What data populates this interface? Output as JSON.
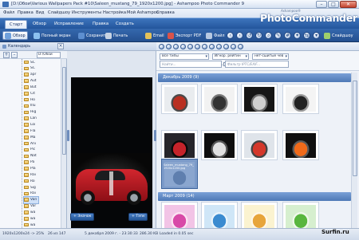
{
  "window": {
    "title": "[D:\\Обои\\Various Wallpapers Pack #10\\Saleen_mustang_79_1920x1200.jpg] - Ashampoo Photo Commander 9",
    "minimize": "–",
    "maximize": "□",
    "close": "✕"
  },
  "menubar": {
    "items": [
      "Файл",
      "Правка",
      "Вид",
      "Слайдшоу",
      "Инструменты",
      "Настройка",
      "Мой Ashampoo",
      "Справка"
    ]
  },
  "logo": {
    "brand": "Ashampoo®",
    "product": "PhotoCommander 9"
  },
  "tabs": [
    "Старт",
    "Обзор",
    "Исправление",
    "Правка",
    "Создать"
  ],
  "toolbar": {
    "items": [
      "Обзор",
      "Полный экран",
      "Сохранить",
      "Печать",
      "Email",
      "Экспорт PDF",
      "Файл",
      "Слайдшоу"
    ],
    "selected": "Обзор"
  },
  "left_panel": {
    "tab_label": "Календарь",
    "path_value": "D:\\Обои",
    "add_label": "+",
    "remove_label": "–",
    "folders": [
      "SC",
      "SC",
      "apr",
      "Aut",
      "But",
      "Cit",
      "Ho",
      "Illu",
      "Hig",
      "Lan",
      "Loi",
      "Fla",
      "Ma",
      "Ani",
      "Pic",
      "Nat",
      "Pa",
      "Pla",
      "Rai",
      "Ro",
      "Sig",
      "Rai",
      "Var",
      "Var",
      "wa",
      "wa",
      "wa"
    ],
    "selected_folder": "Vari"
  },
  "preview": {
    "left_button": "Значок",
    "right_button": "Тэги"
  },
  "right_panel": {
    "type_filter": "Все типы",
    "sort": "Игнор. рейтин",
    "third": "нет-сшитые чев",
    "formats": [
      "GIF",
      "JPG",
      "PNG",
      "TIF",
      "TGA",
      "PSD",
      "AVI",
      "MP3"
    ],
    "search_placeholder": "Найти...",
    "filter_placeholder": "Фильтр IPTC/EXIF...",
    "groups": [
      {
        "title": "Декабрь 2009 (9)"
      },
      {
        "title": "Март 2009 (14)"
      }
    ],
    "selected_caption": "Saleen_mustang_79_1920x1200.jpg"
  },
  "status": {
    "dims": "1920x1200x24 -> 25%",
    "count": "26 из 147",
    "date": "5 декабря 2009 г. - 23:30:33",
    "size": "286.30 KB",
    "loaded": "Loaded in 0.05 sec"
  },
  "watermark": "Surfin.ru",
  "colors": {
    "accent": "#2d60a6",
    "toolbar_bg": "#24508f",
    "group_header": "#5e86c0"
  }
}
